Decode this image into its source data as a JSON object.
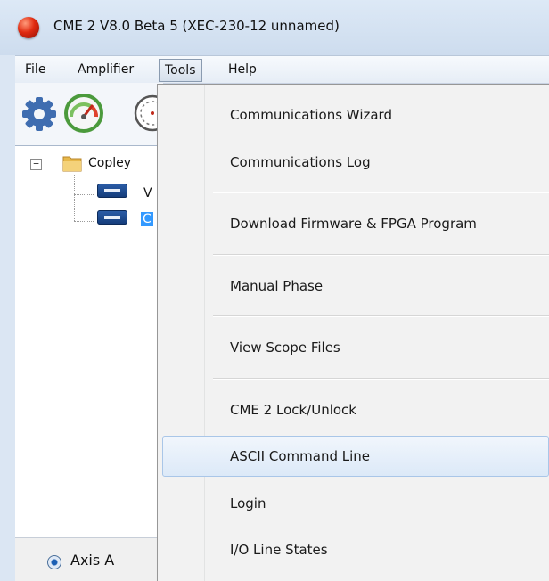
{
  "window": {
    "title": "CME 2 V8.0 Beta 5 (XEC-230-12 unnamed)"
  },
  "menubar": {
    "file": "File",
    "amplifier": "Amplifier",
    "tools": "Tools",
    "help": "Help"
  },
  "tree": {
    "root_label": "Copley",
    "expander": "−",
    "children": [
      {
        "label": "V"
      },
      {
        "label": "C"
      }
    ]
  },
  "axis": {
    "label": "Axis A",
    "selected": true
  },
  "tools_menu": {
    "items": [
      {
        "label": "Communications Wizard"
      },
      {
        "label": "Communications Log"
      },
      {
        "label": "Download Firmware & FPGA Program"
      },
      {
        "label": "Manual Phase"
      },
      {
        "label": "View Scope Files"
      },
      {
        "label": "CME 2 Lock/Unlock"
      },
      {
        "label": "ASCII Command Line",
        "highlighted": true
      },
      {
        "label": "Login"
      },
      {
        "label": "I/O Line States"
      }
    ]
  },
  "icons": [
    "app-icon",
    "gear-icon",
    "gauge-icon",
    "scope-icon",
    "folder-icon",
    "amplifier-icon"
  ],
  "colors": {
    "selection": "#3399ff",
    "accent": "#1b5fb4",
    "app_icon": "#e02a10"
  }
}
